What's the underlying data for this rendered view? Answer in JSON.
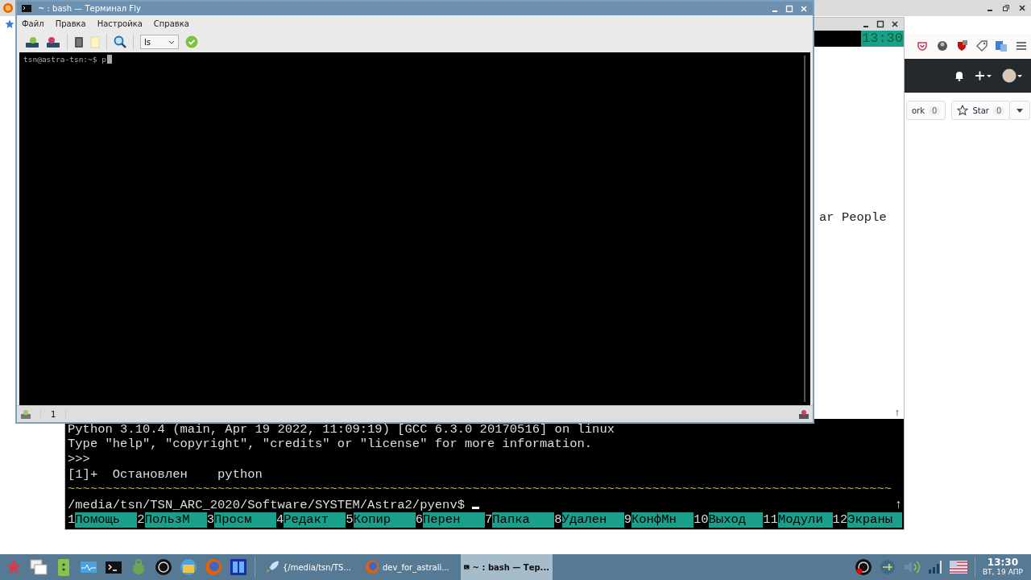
{
  "browser": {
    "repo_buttons": [
      {
        "label": "ork",
        "count": "0"
      },
      {
        "label": "Star",
        "count": "0"
      }
    ]
  },
  "background_terminal": {
    "clock": "13:30",
    "side_text": "ar People",
    "scroll_mark": "↑",
    "lines": [
      "Python 3.10.4 (main, Apr 19 2022, 11:09:19) [GCC 6.3.0 20170516] on linux",
      "Type \"help\", \"copyright\", \"credits\" or \"license\" for more information.",
      ">>>",
      "[1]+  Остановлен    python"
    ],
    "separator": "~~~~~~~~~~~~~~~~~~~~~~~~~~~~~~~~~~~~~~~~~~~~~~~~~~~~~~~~~~~~~~~~~~~~~~~~~~~~~~~~~~~~~~~~~~~~~~~~~~~~~~~~~~~~~~",
    "prompt": "/media/tsn/TSN_ARC_2020/Software/SYSTEM/Astra2/pyenv$",
    "prompt_mark": "↑",
    "function_keys": [
      {
        "number": "1",
        "label": "Помощь"
      },
      {
        "number": "2",
        "label": "ПользМ"
      },
      {
        "number": "3",
        "label": "Просм"
      },
      {
        "number": "4",
        "label": "Редакт"
      },
      {
        "number": "5",
        "label": "Копир"
      },
      {
        "number": "6",
        "label": "Перен"
      },
      {
        "number": "7",
        "label": "Папка"
      },
      {
        "number": "8",
        "label": "Удален"
      },
      {
        "number": "9",
        "label": "КонфМн"
      },
      {
        "number": "10",
        "label": "Выход"
      },
      {
        "number": "11",
        "label": "Модули"
      },
      {
        "number": "12",
        "label": "Экраны"
      }
    ]
  },
  "terminal": {
    "title": "~ : bash — Терминал Fly",
    "menu": [
      "Файл",
      "Правка",
      "Настройка",
      "Справка"
    ],
    "command_combo": "ls",
    "prompt": "tsn@astra-tsn:~$ p",
    "tab_label": "1"
  },
  "taskbar": {
    "tasks": [
      {
        "label": "{/media/tsn/TS...",
        "kind": "rocket",
        "selected": false
      },
      {
        "label": "dev_for_astrali...",
        "kind": "browser",
        "selected": false
      },
      {
        "label": "~ : bash — Тер...",
        "kind": "terminal",
        "selected": true
      }
    ],
    "clock": {
      "time": "13:30",
      "date": "ВТ, 19 АПР"
    }
  }
}
